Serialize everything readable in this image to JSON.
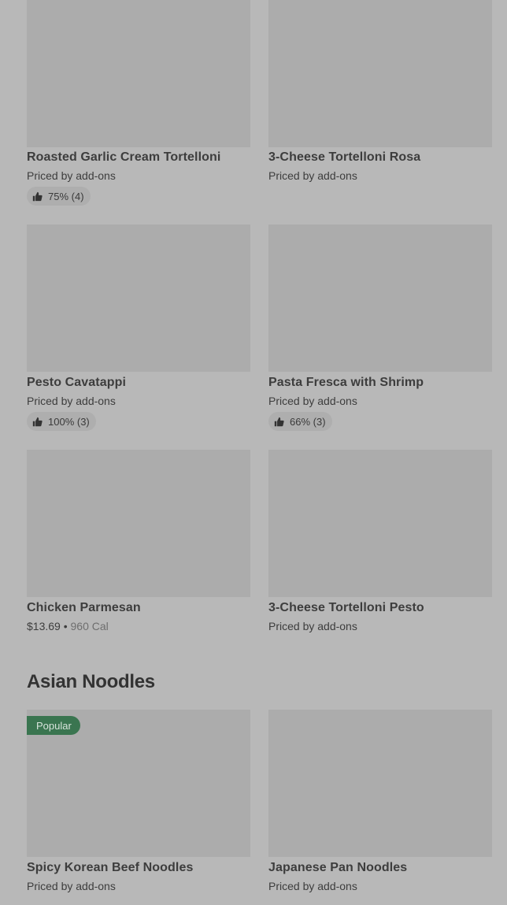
{
  "section": {
    "title": "Asian Noodles"
  },
  "items": [
    {
      "name": "Roasted Garlic Cream Tortelloni",
      "price": "Priced by add-ons",
      "rating": "75% (4)"
    },
    {
      "name": "3-Cheese Tortelloni Rosa",
      "price": "Priced by add-ons"
    },
    {
      "name": "Pesto Cavatappi",
      "price": "Priced by add-ons",
      "rating": "100% (3)"
    },
    {
      "name": "Pasta Fresca with Shrimp",
      "price": "Priced by add-ons",
      "rating": "66% (3)"
    },
    {
      "name": "Chicken Parmesan",
      "price": "$13.69",
      "separator": " • ",
      "calories": "960 Cal"
    },
    {
      "name": "3-Cheese Tortelloni Pesto",
      "price": "Priced by add-ons"
    },
    {
      "name": "Spicy Korean Beef Noodles",
      "price": "Priced by add-ons",
      "badge": "Popular"
    },
    {
      "name": "Japanese Pan Noodles",
      "price": "Priced by add-ons"
    }
  ],
  "icons": {
    "rating": "thumbs-up-icon"
  },
  "colors": {
    "badge_bg": "#3a7550",
    "overlay": "#b8b8b8",
    "thumb": "#acacac"
  }
}
